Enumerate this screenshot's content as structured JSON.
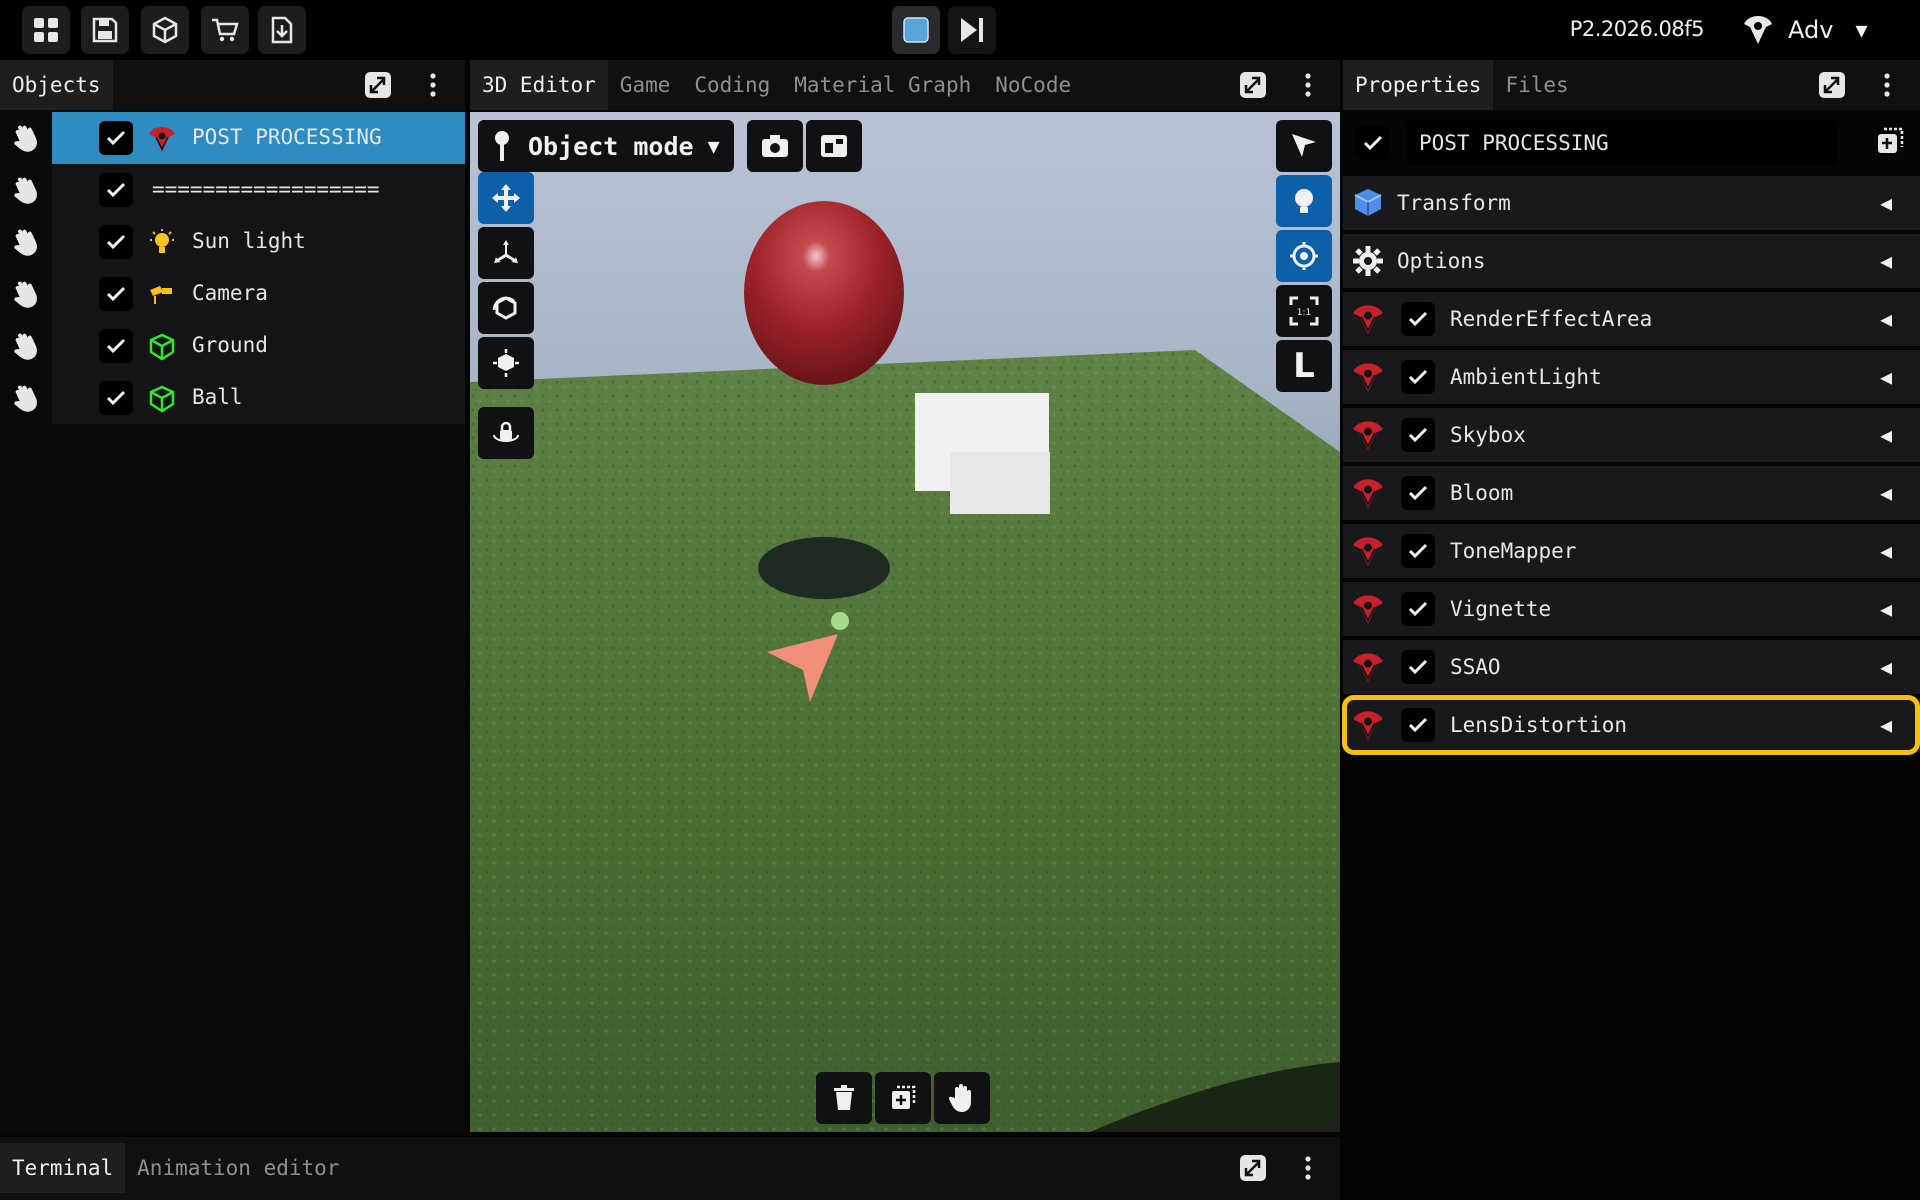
{
  "topbar": {
    "buttons": [
      "grid-menu-icon",
      "save-icon",
      "box-icon",
      "cart-icon",
      "download-icon"
    ],
    "play_controls": [
      "stop-icon",
      "step-forward-icon"
    ],
    "version": "P2.2026.08f5",
    "profile_label": "Adv"
  },
  "objects": {
    "tab": "Objects",
    "items": [
      {
        "label": "POST PROCESSING",
        "icon": "post-processing-icon",
        "checked": true,
        "selected": true
      },
      {
        "label": "==================",
        "icon": "",
        "checked": true,
        "selected": false
      },
      {
        "label": "Sun light",
        "icon": "bulb-icon",
        "checked": true,
        "selected": false
      },
      {
        "label": "Camera",
        "icon": "camera-icon",
        "checked": true,
        "selected": false
      },
      {
        "label": "Ground",
        "icon": "mesh-icon",
        "checked": true,
        "selected": false
      },
      {
        "label": "Ball",
        "icon": "mesh-icon",
        "checked": true,
        "selected": false
      }
    ]
  },
  "editor": {
    "tabs": [
      "3D Editor",
      "Game",
      "Coding",
      "Material Graph",
      "NoCode"
    ],
    "active_tab": "3D Editor",
    "mode": "Object mode",
    "right_tools": [
      "cursor-icon",
      "light-toggle-icon",
      "focus-icon",
      "one-to-one-icon",
      "L"
    ],
    "left_tools": [
      "move-icon",
      "scale-icon",
      "rotate-icon",
      "transform-icon",
      "lock-camera-icon"
    ],
    "bottom_tools": [
      "trash-icon",
      "duplicate-icon",
      "hand-icon"
    ]
  },
  "properties": {
    "tabs": [
      "Properties",
      "Files"
    ],
    "active_tab": "Properties",
    "name_value": "POST PROCESSING",
    "sections": [
      {
        "label": "Transform",
        "icon": "cube-icon"
      },
      {
        "label": "Options",
        "icon": "gear-icon"
      }
    ],
    "effects": [
      {
        "label": "RenderEffectArea",
        "checked": true
      },
      {
        "label": "AmbientLight",
        "checked": true
      },
      {
        "label": "Skybox",
        "checked": true
      },
      {
        "label": "Bloom",
        "checked": true
      },
      {
        "label": "ToneMapper",
        "checked": true
      },
      {
        "label": "Vignette",
        "checked": true
      },
      {
        "label": "SSAO",
        "checked": true
      },
      {
        "label": "LensDistortion",
        "checked": true,
        "highlighted": true
      }
    ],
    "highlight_color": "#f4c20d"
  },
  "bottom": {
    "tabs": [
      "Terminal",
      "Animation editor"
    ],
    "active_tab": "Terminal"
  },
  "colors": {
    "selected_row": "#2f8cc0",
    "tool_active": "#0d5fa8",
    "effect_icon": "#c8202a",
    "mesh_icon": "#2ee82e"
  }
}
